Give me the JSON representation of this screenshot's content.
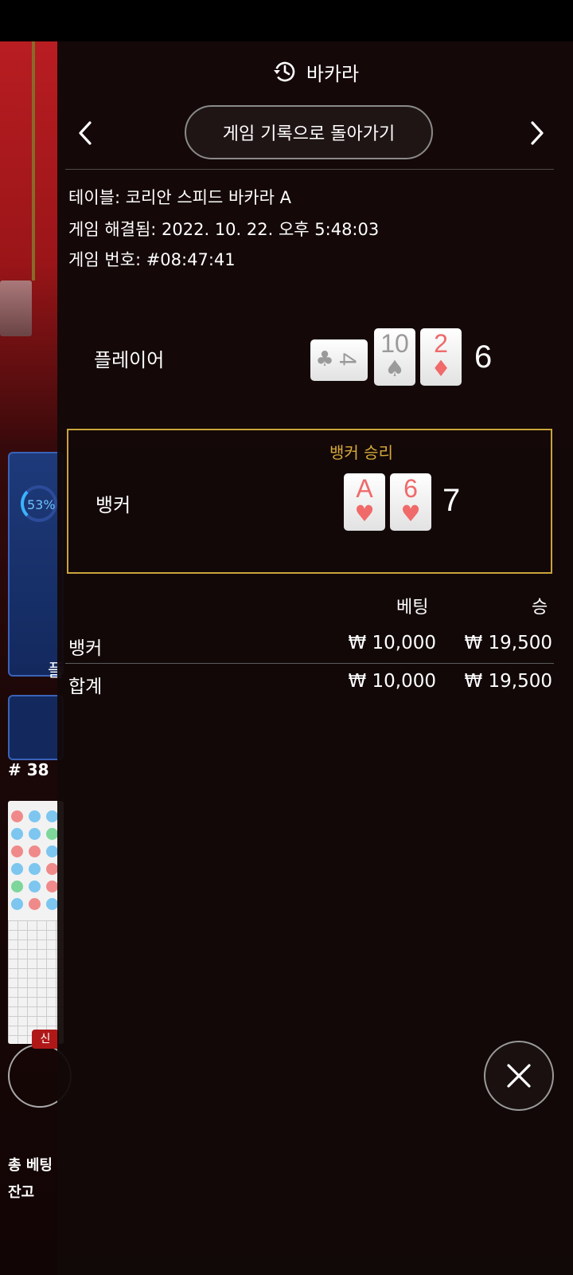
{
  "header": {
    "title": "바카라",
    "history_icon": "history-icon"
  },
  "nav": {
    "back_label": "게임 기록으로 돌아가기",
    "prev_icon": "chevron-left-icon",
    "next_icon": "chevron-right-icon"
  },
  "info": {
    "table": "테이블: 코리안 스피드 바카라 A",
    "resolved": "게임 해결됨: 2022. 10. 22. 오후 5:48:03",
    "number": "게임 번호: #08:47:41"
  },
  "player": {
    "label": "플레이어",
    "score": "6",
    "cards": [
      {
        "rank": "4",
        "suit": "♣",
        "color": "grey",
        "orientation": "sideways"
      },
      {
        "rank": "10",
        "suit": "♠",
        "color": "grey"
      },
      {
        "rank": "2",
        "suit": "♦",
        "color": "red"
      }
    ]
  },
  "banker": {
    "label": "뱅커",
    "winner_label": "뱅커 승리",
    "score": "7",
    "cards": [
      {
        "rank": "A",
        "suit": "♥",
        "color": "red"
      },
      {
        "rank": "6",
        "suit": "♥",
        "color": "red"
      }
    ]
  },
  "bets": {
    "columns": {
      "bet": "베팅",
      "win": "승"
    },
    "rows": [
      {
        "name": "뱅커",
        "bet": "₩ 10,000",
        "win": "₩ 19,500"
      }
    ],
    "total": {
      "name": "합계",
      "bet": "₩ 10,000",
      "win": "₩ 19,500"
    }
  },
  "close_icon": "close-icon",
  "background": {
    "stat_percent": "53%",
    "stat_glyph": "플",
    "round_number": "# 38",
    "new_badge": "신",
    "total_bet_label": "총 베팅",
    "balance_label": "잔고"
  },
  "colors": {
    "accent_gold": "#c8a43c",
    "winner_text": "#d6a93a",
    "panel_bg": "#120808"
  }
}
